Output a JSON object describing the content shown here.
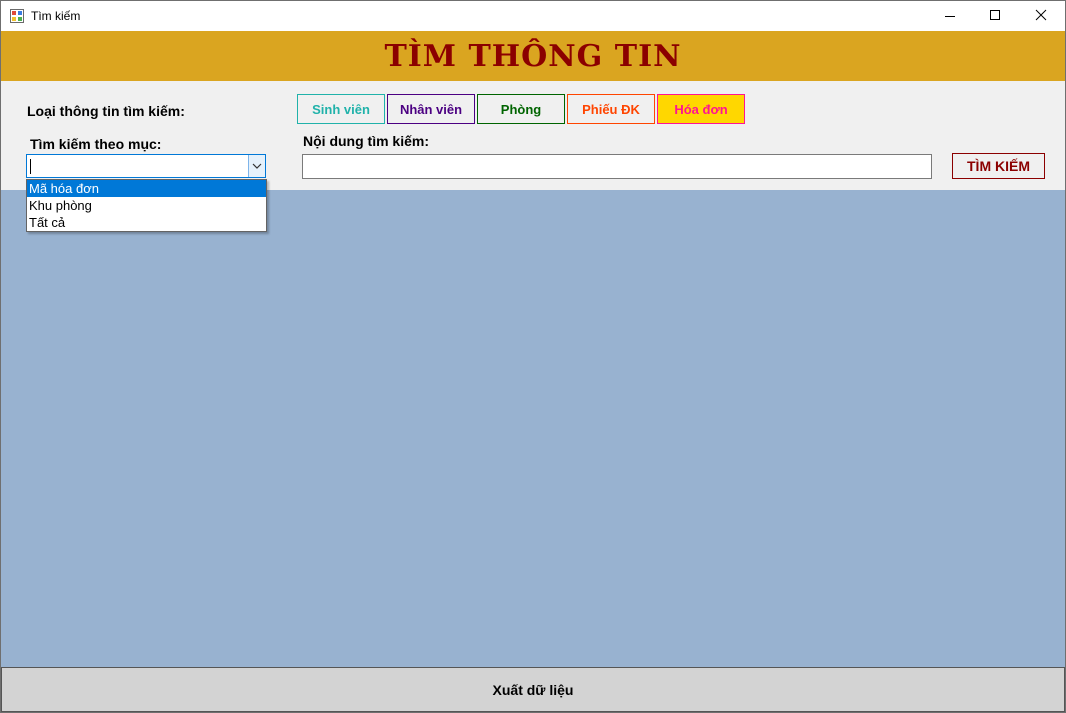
{
  "window": {
    "title": "Tìm kiếm",
    "controls": {
      "minimize": "minimize-icon",
      "maximize": "maximize-icon",
      "close": "close-icon"
    }
  },
  "header": {
    "title": "TÌM THÔNG TIN",
    "background": "#daa520",
    "color": "#8b0000"
  },
  "form": {
    "type_label": "Loại thông tin tìm kiếm:",
    "types": [
      {
        "label": "Sinh viên",
        "color": "#20b2aa"
      },
      {
        "label": "Nhân viên",
        "color": "#4b0082"
      },
      {
        "label": "Phòng",
        "color": "#006400"
      },
      {
        "label": "Phiếu ĐK",
        "color": "#ff4500"
      },
      {
        "label": "Hóa đơn",
        "color": "#ff1493",
        "background": "#ffd700"
      }
    ],
    "category_label": "Tìm kiếm theo mục:",
    "category_value": "",
    "category_options": [
      "Mã hóa đơn",
      "Khu phòng",
      "Tất cả"
    ],
    "category_highlighted": "Mã hóa đơn",
    "content_label": "Nội dung tìm kiếm:",
    "content_value": "",
    "search_button": "TÌM KIẾM"
  },
  "results": {
    "background": "#98b2d0"
  },
  "footer": {
    "export_button": "Xuất dữ liệu"
  }
}
